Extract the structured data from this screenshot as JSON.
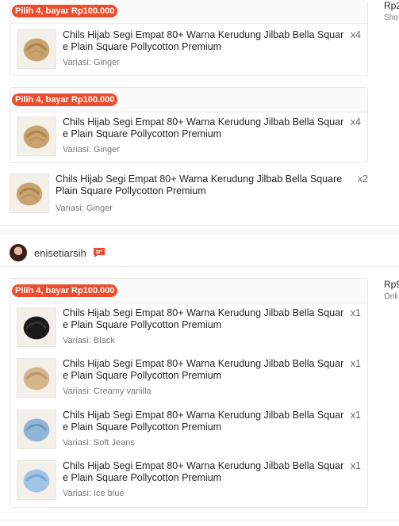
{
  "shop1": {
    "price_prefix": "Rp2",
    "price_sub": "Sho",
    "bundles": [
      {
        "badge": "Pilih 4, bayar Rp100.000",
        "items": [
          {
            "title": "Chils Hijab Segi Empat 80+ Warna Kerudung Jilbab Bella Square Plain Square Pollycotton Premium",
            "qty": "x4",
            "variant": "Variasi: Ginger",
            "color": "#c9a36e"
          }
        ]
      },
      {
        "badge": "Pilih 4, bayar Rp100.000",
        "items": [
          {
            "title": "Chils Hijab Segi Empat 80+ Warna Kerudung Jilbab Bella Square Plain Square Pollycotton Premium",
            "qty": "x4",
            "variant": "Variasi: Ginger",
            "color": "#c9a36e"
          }
        ]
      }
    ],
    "loose_item": {
      "title": "Chils Hijab Segi Empat 80+ Warna Kerudung Jilbab Bella Square Plain Square Pollycotton Premium",
      "qty": "x2",
      "variant": "Variasi: Ginger",
      "color": "#c9a36e"
    }
  },
  "shop2": {
    "name": "enisetiarsih",
    "price_prefix": "Rp9",
    "price_sub": "Onli",
    "bundle": {
      "badge": "Pilih 4, bayar Rp100.000",
      "items": [
        {
          "title": "Chils Hijab Segi Empat 80+ Warna Kerudung Jilbab Bella Square Plain Square Pollycotton Premium",
          "qty": "x1",
          "variant": "Variasi: Black",
          "color": "#1a1a1a"
        },
        {
          "title": "Chils Hijab Segi Empat 80+ Warna Kerudung Jilbab Bella Square Plain Square Pollycotton Premium",
          "qty": "x1",
          "variant": "Variasi: Creamy vanilla",
          "color": "#d6b48c"
        },
        {
          "title": "Chils Hijab Segi Empat 80+ Warna Kerudung Jilbab Bella Square Plain Square Pollycotton Premium",
          "qty": "x1",
          "variant": "Variasi: Soft Jeans",
          "color": "#8fb6d4"
        },
        {
          "title": "Chils Hijab Segi Empat 80+ Warna Kerudung Jilbab Bella Square Plain Square Pollycotton Premium",
          "qty": "x1",
          "variant": "Variasi: Ice blue",
          "color": "#9fc4e6"
        }
      ]
    }
  },
  "icons": {
    "chat": "chat-icon",
    "thumbnail": "hijab-thumbnail-icon"
  },
  "colors": {
    "accent": "#ee4d2d"
  }
}
